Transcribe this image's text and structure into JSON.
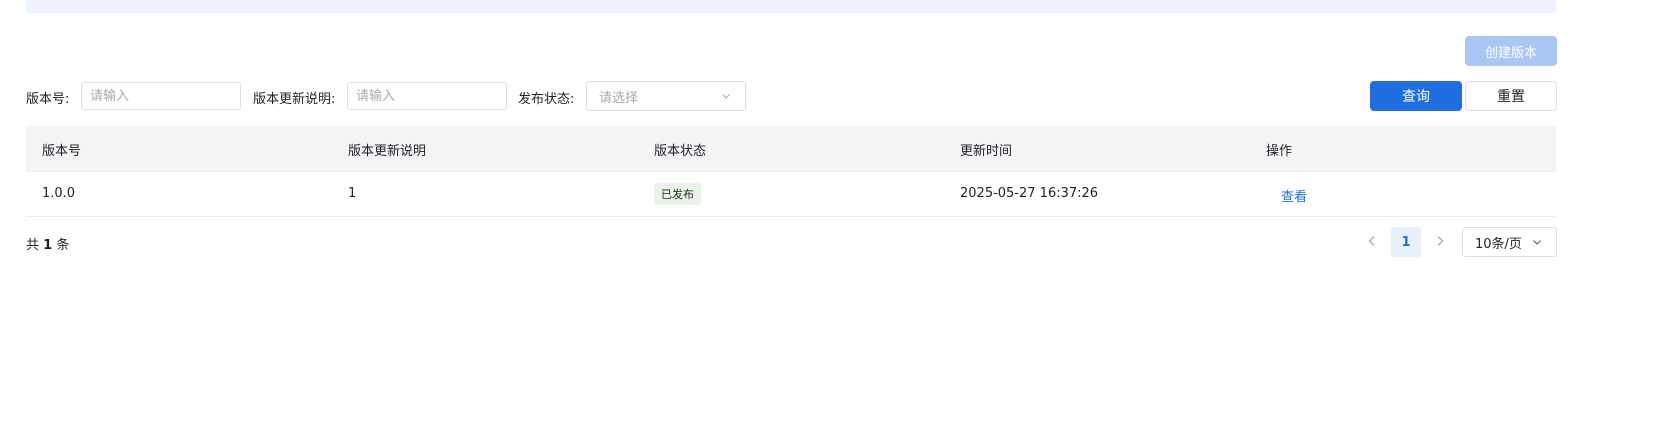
{
  "toolbar": {
    "create_label": "创建版本",
    "query_label": "查询",
    "reset_label": "重置"
  },
  "filters": {
    "version_label": "版本号:",
    "version_placeholder": "请输入",
    "version_value": "",
    "desc_label": "版本更新说明:",
    "desc_placeholder": "请输入",
    "desc_value": "",
    "status_label": "发布状态:",
    "status_placeholder": "请选择"
  },
  "table": {
    "headers": [
      "版本号",
      "版本更新说明",
      "版本状态",
      "更新时间",
      "操作"
    ],
    "rows": [
      {
        "version": "1.0.0",
        "description": "1",
        "status": "已发布",
        "updated_at": "2025-05-27 16:37:26",
        "action": "查看"
      }
    ]
  },
  "pagination": {
    "total_prefix": "共",
    "total_count": "1",
    "total_suffix": "条",
    "current_page": "1",
    "page_size": "10条/页"
  },
  "colors": {
    "primary": "#1f6ee0",
    "primary_disabled": "#aac6f3",
    "success_tag_bg": "#e8f5e4",
    "header_bg": "#f4f4f5"
  }
}
